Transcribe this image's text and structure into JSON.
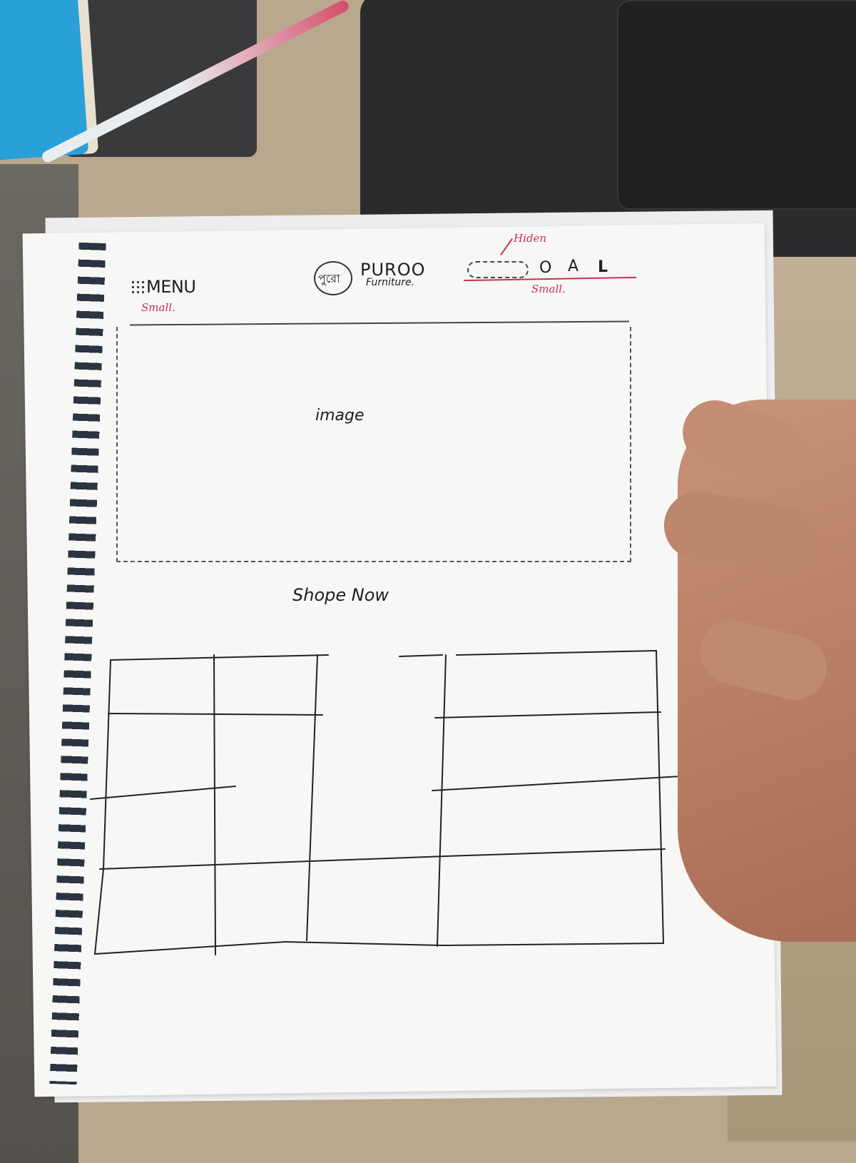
{
  "sketch": {
    "header": {
      "menu_label": "MENU",
      "menu_note": "Small.",
      "logo_glyph": "পুরো",
      "brand_name": "PUROO",
      "brand_subtitle": "Furniture.",
      "search_note": "Hiden",
      "icons_note": "Small.",
      "icons": [
        "circle-icon",
        "user-icon",
        "bag-icon"
      ],
      "icon_glyphs": {
        "circle": "O",
        "user": "A",
        "bag": "L"
      }
    },
    "hero": {
      "placeholder_label": "image"
    },
    "cta": {
      "label": "Shope Now"
    }
  },
  "colors": {
    "ink": "#1e1e1e",
    "annotation": "#c8314f",
    "paper": "#f7f7f5"
  }
}
